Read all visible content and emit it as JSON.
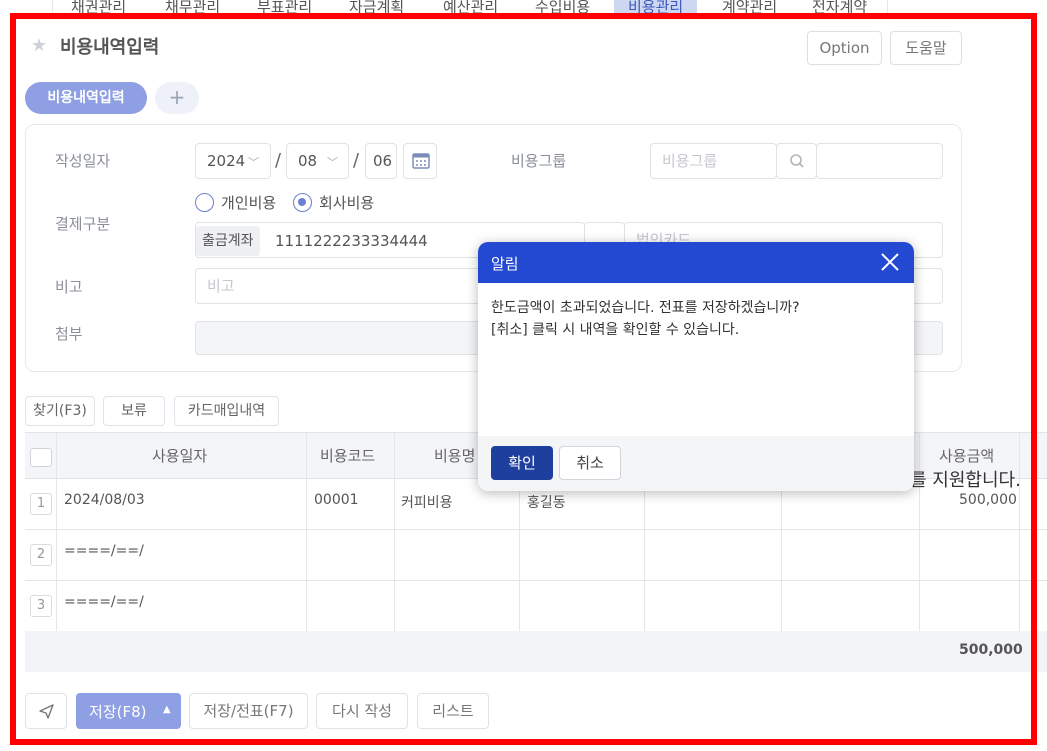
{
  "nav": {
    "tabs": [
      {
        "label": "채권관리"
      },
      {
        "label": "채무관리"
      },
      {
        "label": "부표관리"
      },
      {
        "label": "자금계획"
      },
      {
        "label": "예산관리"
      },
      {
        "label": "수입비용"
      },
      {
        "label": "비용관리"
      },
      {
        "label": "계약관리"
      },
      {
        "label": "전자계약"
      }
    ],
    "active_index": 6
  },
  "header": {
    "title": "비용내역입력",
    "option_label": "Option",
    "help_label": "도움말"
  },
  "tabs": {
    "current": "비용내역입력",
    "add": "+"
  },
  "form": {
    "date_label": "작성일자",
    "year": "2024",
    "month": "08",
    "day": "06",
    "slash": "/",
    "group_label": "비용그룹",
    "group_placeholder": "비용그룹",
    "payment_label": "결제구분",
    "radio_personal": "개인비용",
    "radio_company": "회사비용",
    "account_tag": "출금계좌",
    "account_value": "1111222233334444",
    "card_placeholder": "법인카드",
    "note_label": "비고",
    "note_placeholder": "비고",
    "attach_label": "첨부"
  },
  "toolbar": {
    "find": "찾기(F3)",
    "hold": "보류",
    "card_history": "카드매입내역"
  },
  "grid": {
    "headers": [
      "사용일자",
      "비용코드",
      "비용명",
      "사용금액"
    ],
    "rows": [
      {
        "num": "1",
        "date": "2024/08/03",
        "code": "00001",
        "name": "커피비용",
        "person": "홍길동",
        "amount": "500,000"
      },
      {
        "num": "2",
        "date": "====/==/"
      },
      {
        "num": "3",
        "date": "====/==/"
      }
    ],
    "total": "500,000"
  },
  "stray_text": "를 지원합니다.",
  "bottom": {
    "save": "저장(F8)",
    "save_slip": "저장/전표(F7)",
    "rewrite": "다시 작성",
    "list": "리스트"
  },
  "modal": {
    "title": "알림",
    "line1": "한도금액이 초과되었습니다. 전표를 저장하겠습니까?",
    "line2": "[취소] 클릭 시 내역을 확인할 수 있습니다.",
    "ok": "확인",
    "cancel": "취소"
  },
  "colors": {
    "modal_header": "#2349d2",
    "accent": "#8e9fe4",
    "frame": "#ff0000"
  }
}
